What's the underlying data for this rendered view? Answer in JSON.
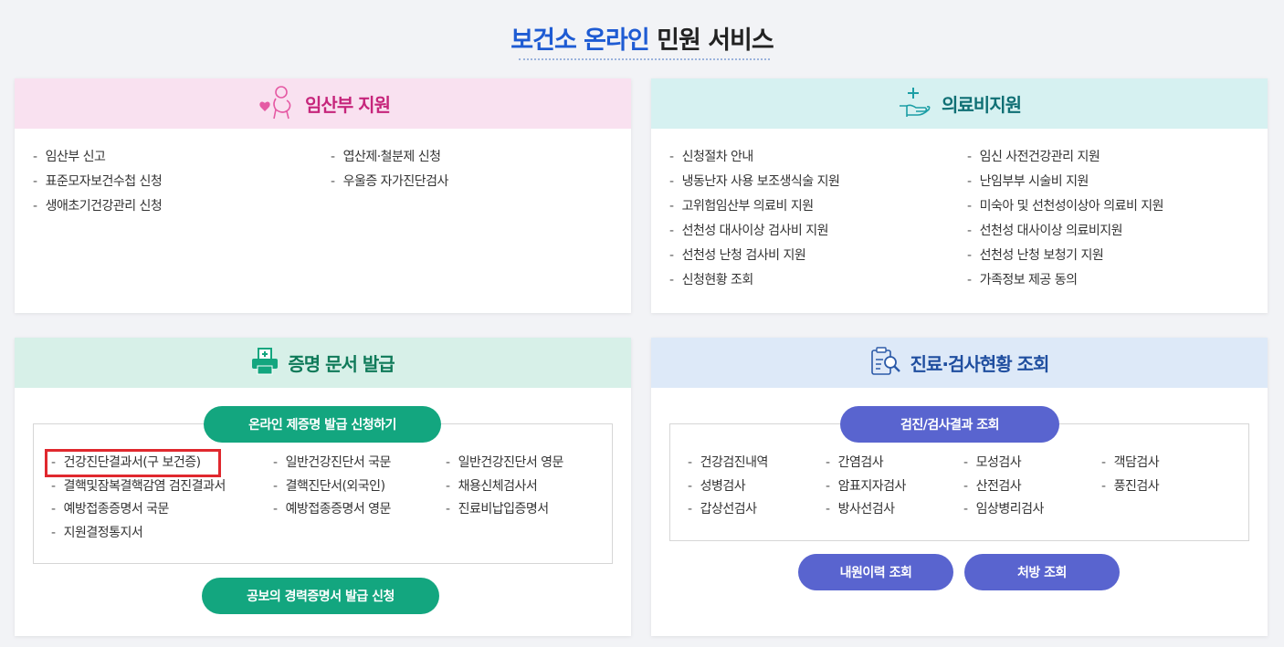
{
  "header": {
    "title_blue": "보건소 온라인",
    "title_dark": "민원 서비스"
  },
  "pregnant": {
    "title": "임산부 지원",
    "col1": [
      "임산부 신고",
      "표준모자보건수첩 신청",
      "생애초기건강관리 신청"
    ],
    "col2": [
      "엽산제·철분제 신청",
      "우울증 자가진단검사"
    ]
  },
  "medical": {
    "title": "의료비지원",
    "col1": [
      "신청절차 안내",
      "냉동난자 사용 보조생식술 지원",
      "고위험임산부 의료비 지원",
      "선천성 대사이상 검사비 지원",
      "선천성 난청 검사비 지원",
      "신청현황 조회"
    ],
    "col2": [
      "임신 사전건강관리 지원",
      "난임부부 시술비 지원",
      "미숙아 및 선천성이상아 의료비 지원",
      "선천성 대사이상 의료비지원",
      "선천성 난청 보청기 지원",
      "가족정보 제공 동의"
    ]
  },
  "cert": {
    "title": "증명 문서 발급",
    "top_button": "온라인 제증명 발급 신청하기",
    "bottom_button": "공보의 경력증명서 발급 신청",
    "col1": [
      "건강진단결과서(구 보건증)",
      "결핵및잠복결핵감염 검진결과서",
      "예방접종증명서 국문",
      "지원결정통지서"
    ],
    "col2": [
      "일반건강진단서 국문",
      "결핵진단서(외국인)",
      "예방접종증명서 영문"
    ],
    "col3": [
      "일반건강진단서 영문",
      "채용신체검사서",
      "진료비납입증명서"
    ]
  },
  "exam": {
    "title": "진료·검사현황 조회",
    "top_button": "검진/검사결과 조회",
    "col1": [
      "건강검진내역",
      "성병검사",
      "갑상선검사"
    ],
    "col2": [
      "간염검사",
      "암표지자검사",
      "방사선검사"
    ],
    "col3": [
      "모성검사",
      "산전검사",
      "임상병리검사"
    ],
    "col4": [
      "객담검사",
      "풍진검사"
    ],
    "visit_button": "내원이력 조회",
    "prescription_button": "처방 조회"
  },
  "colors": {
    "accent_blue": "#1e5bd3",
    "green_button": "#13a67f",
    "blue_button": "#5964cf",
    "highlight": "#e0282e"
  }
}
